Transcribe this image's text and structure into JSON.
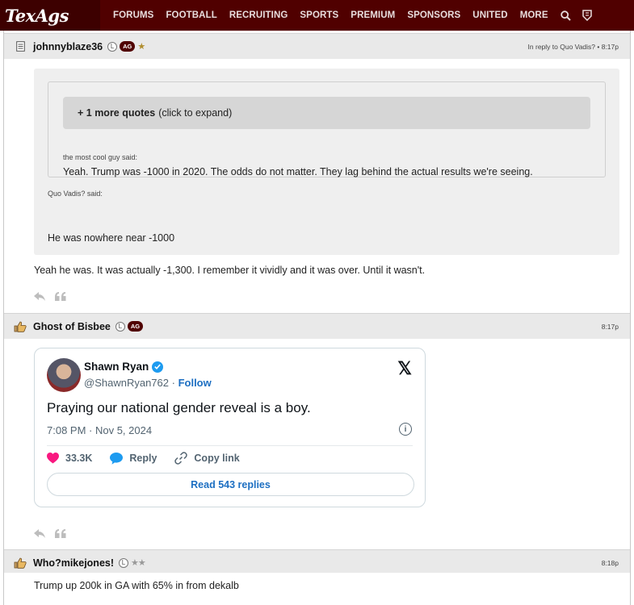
{
  "nav": {
    "logo": "TexAgs",
    "items": [
      "FORUMS",
      "FOOTBALL",
      "RECRUITING",
      "SPORTS",
      "PREMIUM",
      "SPONSORS",
      "UNITED",
      "MORE"
    ]
  },
  "post1": {
    "username": "johnnyblaze36",
    "badge_l": "L",
    "badge_ag": "AG",
    "reply_info": "In reply to Quo Vadis? • 8:17p",
    "more_quotes_bold": "+ 1 more quotes",
    "more_quotes_rest": "(click to expand)",
    "inner_author": "the most cool guy said:",
    "inner_text": "Yeah. Trump was -1000 in 2020. The odds do not matter. They lag behind the actual results we're seeing.",
    "outer_author": "Quo Vadis? said:",
    "outer_text": "He was nowhere near -1000",
    "body": "Yeah he was. It was actually -1,300. I remember it vividly and it was over. Until it wasn't."
  },
  "post2": {
    "username": "Ghost of Bisbee",
    "badge_l": "L",
    "badge_ag": "AG",
    "time": "8:17p",
    "tweet": {
      "name": "Shawn Ryan",
      "handle": "@ShawnRyan762",
      "separator": "·",
      "follow": "Follow",
      "text": "Praying our national gender reveal is a boy.",
      "timestamp": "7:08 PM · Nov 5, 2024",
      "likes": "33.3K",
      "reply": "Reply",
      "copy": "Copy link",
      "read": "Read 543 replies"
    }
  },
  "post3": {
    "username": "Who?mikejones!",
    "badge_l": "L",
    "stars": "★★",
    "time": "8:18p",
    "body": "Trump up 200k in GA with 65% in from dekalb"
  },
  "colors": {
    "nav_bg": "#500000",
    "ag_badge": "#500000",
    "twitter_blue": "#1d9bf0",
    "like_pink": "#f91880"
  }
}
